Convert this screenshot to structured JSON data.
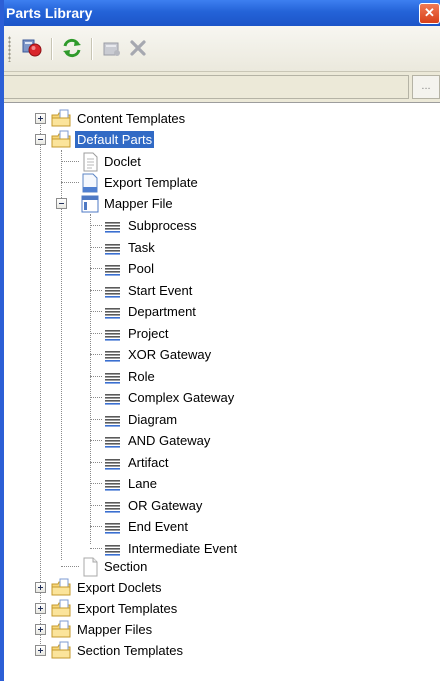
{
  "window": {
    "title": "Parts Library",
    "close_glyph": "✕"
  },
  "toolbar": {
    "buttons": [
      {
        "icon": "add-parts-icon"
      },
      {
        "icon": "refresh-icon"
      },
      {
        "icon": "new-item-icon"
      },
      {
        "icon": "delete-icon"
      }
    ]
  },
  "address": {
    "value": "",
    "browse_label": "..."
  },
  "tree": {
    "content_templates": "Content Templates",
    "default_parts": "Default Parts",
    "doclet": "Doclet",
    "export_template": "Export Template",
    "mapper_file": "Mapper File",
    "mapper_items": [
      "Subprocess",
      "Task",
      "Pool",
      "Start Event",
      "Department",
      "Project",
      "XOR Gateway",
      "Role",
      "Complex Gateway",
      "Diagram",
      "AND Gateway",
      "Artifact",
      "Lane",
      "OR Gateway",
      "End Event",
      "Intermediate Event"
    ],
    "section": "Section",
    "export_doclets": "Export Doclets",
    "export_templates": "Export Templates",
    "mapper_files": "Mapper Files",
    "section_templates": "Section Templates"
  }
}
